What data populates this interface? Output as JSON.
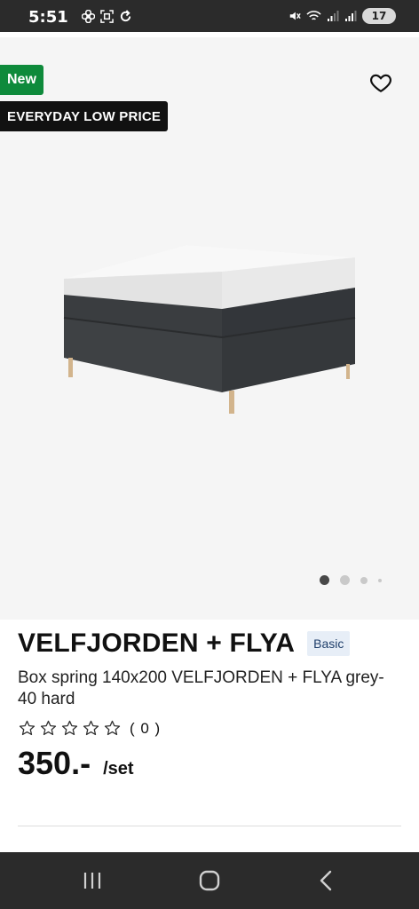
{
  "status_bar": {
    "time": "5:51",
    "battery": "17",
    "icons": [
      "fan-icon",
      "screenshot-icon",
      "sync-icon",
      "mute-icon",
      "wifi-icon",
      "signal-icon",
      "signal-icon",
      "battery-icon"
    ]
  },
  "product": {
    "badges": {
      "new": "New",
      "price": "EVERYDAY LOW PRICE"
    },
    "name": "VELFJORDEN + FLYA",
    "tag": "Basic",
    "description": "Box spring 140x200 VELFJORDEN + FLYA grey-40 hard",
    "rating": {
      "stars": 0,
      "max": 5,
      "count_text": "( 0 )"
    },
    "price": "350.-",
    "unit": "/set"
  },
  "carousel": {
    "total": 4,
    "active": 1
  },
  "nav": {
    "icons": [
      "recent-apps-icon",
      "home-icon",
      "back-icon"
    ]
  },
  "colors": {
    "badge_new": "#0e8a3b",
    "badge_price": "#111111",
    "tag_bg": "#e7eef7",
    "bed": "#3a3d40"
  }
}
